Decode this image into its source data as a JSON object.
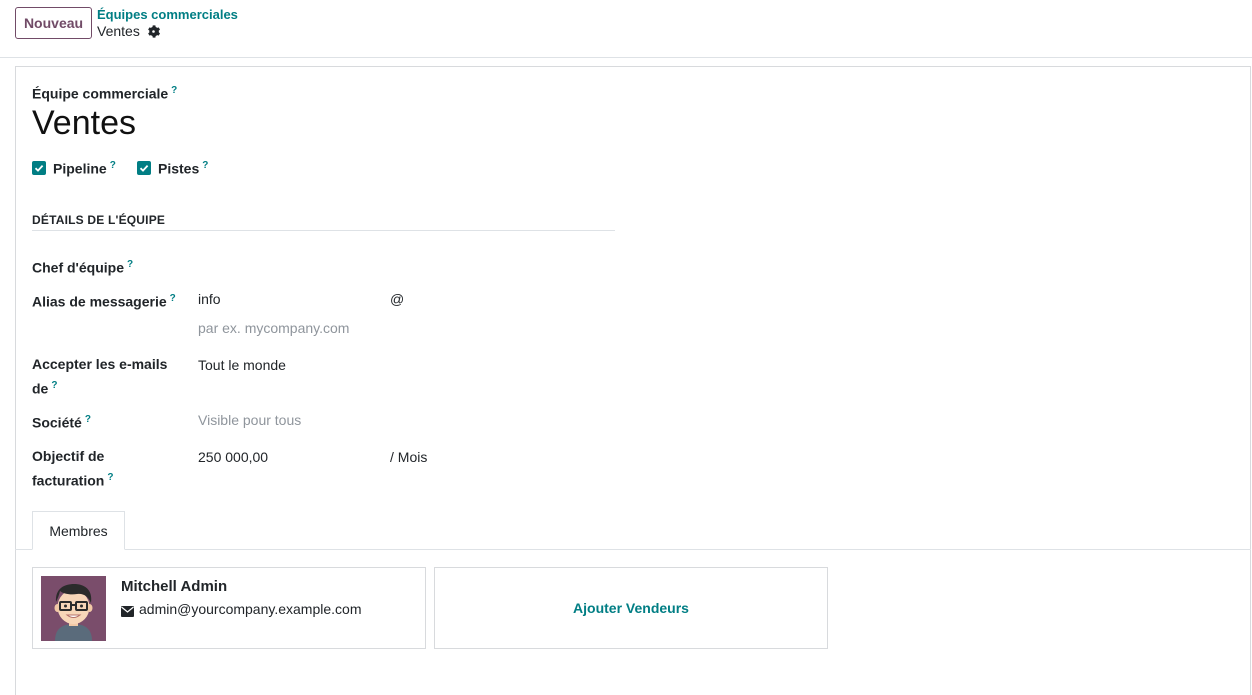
{
  "control_panel": {
    "new_button": "Nouveau",
    "breadcrumb_parent": "Équipes commerciales",
    "breadcrumb_current": "Ventes",
    "gear_icon": "gear-icon"
  },
  "form": {
    "team_label": "Équipe commerciale",
    "help_mark": "?",
    "team_name": "Ventes",
    "checkboxes": [
      {
        "label": "Pipeline",
        "checked": true
      },
      {
        "label": "Pistes",
        "checked": true
      }
    ],
    "section_title": "DÉTAILS DE L'ÉQUIPE",
    "fields": {
      "leader": {
        "label": "Chef d'équipe",
        "value": ""
      },
      "alias": {
        "label": "Alias de messagerie",
        "value": "info",
        "at": "@",
        "domain_placeholder": "par ex. mycompany.com"
      },
      "accept_emails": {
        "label_line1": "Accepter les e-mails",
        "label_line2": "de",
        "value": "Tout le monde"
      },
      "company": {
        "label": "Société",
        "placeholder": "Visible pour tous"
      },
      "invoicing_target": {
        "label_line1": "Objectif de",
        "label_line2": "facturation",
        "value": "250 000,00",
        "unit": "/ Mois"
      }
    }
  },
  "tabs": [
    {
      "label": "Membres",
      "active": true
    }
  ],
  "members": [
    {
      "name": "Mitchell Admin",
      "email": "admin@yourcompany.example.com"
    }
  ],
  "add_salesperson": "Ajouter Vendeurs",
  "colors": {
    "primary": "#714B67",
    "accent": "#017e84"
  }
}
